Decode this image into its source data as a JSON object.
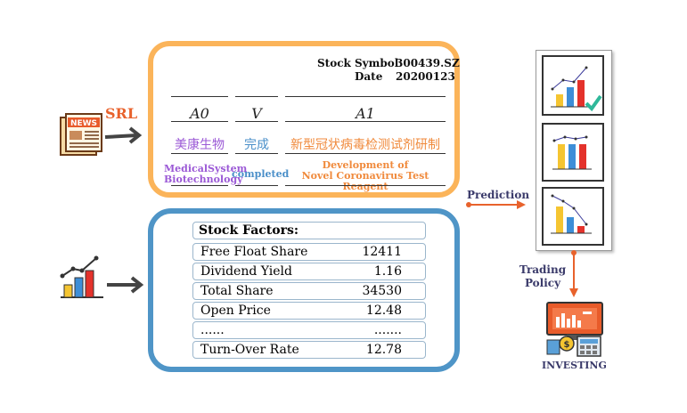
{
  "srl": {
    "label": "SRL",
    "stock_symbol_label": "Stock Symbol",
    "stock_symbol_value": "300439.SZ",
    "date_label": "Date",
    "date_value": "20200123",
    "roles": [
      "A0",
      "V",
      "A1"
    ],
    "zh": [
      "美康生物",
      "完成",
      "新型冠状病毒检测试剂研制"
    ],
    "en": [
      "MedicalSystem\nBiotechnology",
      "completed",
      "Development of\nNovel Coronavirus Test Reagent"
    ],
    "colors": [
      "#9b59d6",
      "#4a8fc9",
      "#f08a3c"
    ]
  },
  "factors": {
    "title": "Stock Factors:",
    "rows": [
      {
        "name": "Free Float Share",
        "value": "12411"
      },
      {
        "name": "Dividend Yield",
        "value": "1.16"
      },
      {
        "name": "Total Share",
        "value": "34530"
      },
      {
        "name": "Open Price",
        "value": "12.48"
      },
      {
        "name": "......",
        "value": "......."
      },
      {
        "name": "Turn-Over Rate",
        "value": "12.78"
      }
    ]
  },
  "prediction_label": "Prediction",
  "trading_policy_label": "Trading\nPolicy",
  "investing_label": "INVESTING",
  "icons": [
    "news-icon",
    "growth-chart-icon",
    "chart-check-icon",
    "chart-flat-icon",
    "chart-decline-icon",
    "investing-icon"
  ]
}
